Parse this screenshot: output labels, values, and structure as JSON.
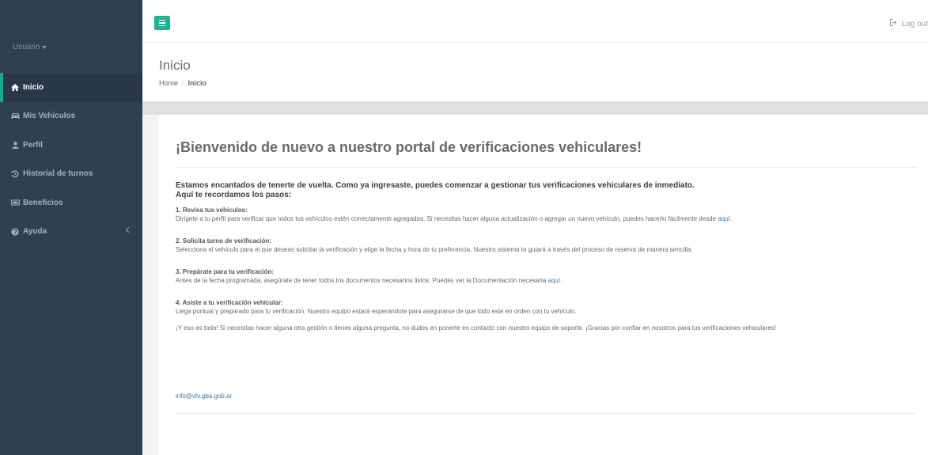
{
  "sidebar": {
    "user_label": "Usuario",
    "items": [
      {
        "label": "Inicio",
        "icon": "home-icon",
        "active": true
      },
      {
        "label": "Mis Vehículos",
        "icon": "car-icon",
        "active": false
      },
      {
        "label": "Perfil",
        "icon": "user-icon",
        "active": false
      },
      {
        "label": "Historial de turnos",
        "icon": "history-icon",
        "active": false
      },
      {
        "label": "Beneficios",
        "icon": "ticket-icon",
        "active": false
      },
      {
        "label": "Ayuda",
        "icon": "question-circle-icon",
        "active": false
      }
    ]
  },
  "topbar": {
    "logout_label": "Log out"
  },
  "heading": {
    "title": "Inicio",
    "breadcrumb_home": "Home",
    "breadcrumb_sep": "/",
    "breadcrumb_current": "Inicio"
  },
  "main": {
    "title": "¡Bienvenido de nuevo a nuestro portal de verificaciones vehiculares!",
    "intro_line1": "Estamos encantados de tenerte de vuelta. Como ya ingresaste, puedes comenzar a gestionar tus verificaciones vehiculares de inmediato.",
    "intro_line2": "Aquí te recordamos los pasos:",
    "step1_title": "1. Revisa tus vehículos:",
    "step1_text": "Dirígete a tu perfil para verificar que todos tus vehículos estén correctamente agregados. Si necesitas hacer alguna actualización o agregar un nuevo vehículo, puedes hacerlo fácilmente desde",
    "step1_link": "aquí.",
    "step2_title": "2. Solicita turno de verificación:",
    "step2_text": "Selecciona el vehículo para el que deseas solicitar la verificación y elige la fecha y hora de tu preferencia. Nuestro sistema te guiará a través del proceso de reserva de manera sencilla.",
    "step3_title": "3. Prepárate para tu verificación:",
    "step3_text": "Antes de la fecha programada, asegúrate de tener todos los documentos necesarios listos. Puedes ver la Documentación necesaria",
    "step3_link": "aquí.",
    "step4_title": "4. Asiste a tu verificación vehicular:",
    "step4_text": "Llega puntual y preparado para tu verificación. Nuestro equipo estará esperándote para asegurarse de que todo esté en orden con tu vehículo.",
    "closing": "¡Y eso es todo! Si necesitas hacer alguna otra gestión o tienes alguna pregunta, no dudes en ponerte en contacto con nuestro equipo de soporte. ¡Gracias por confiar en nosotros para tus verificaciones vehiculares!",
    "email": "info@vtv.gba.gob.ar"
  },
  "colors": {
    "sidebar_bg": "#2f4050",
    "accent": "#1ab394",
    "link": "#337ab7"
  }
}
